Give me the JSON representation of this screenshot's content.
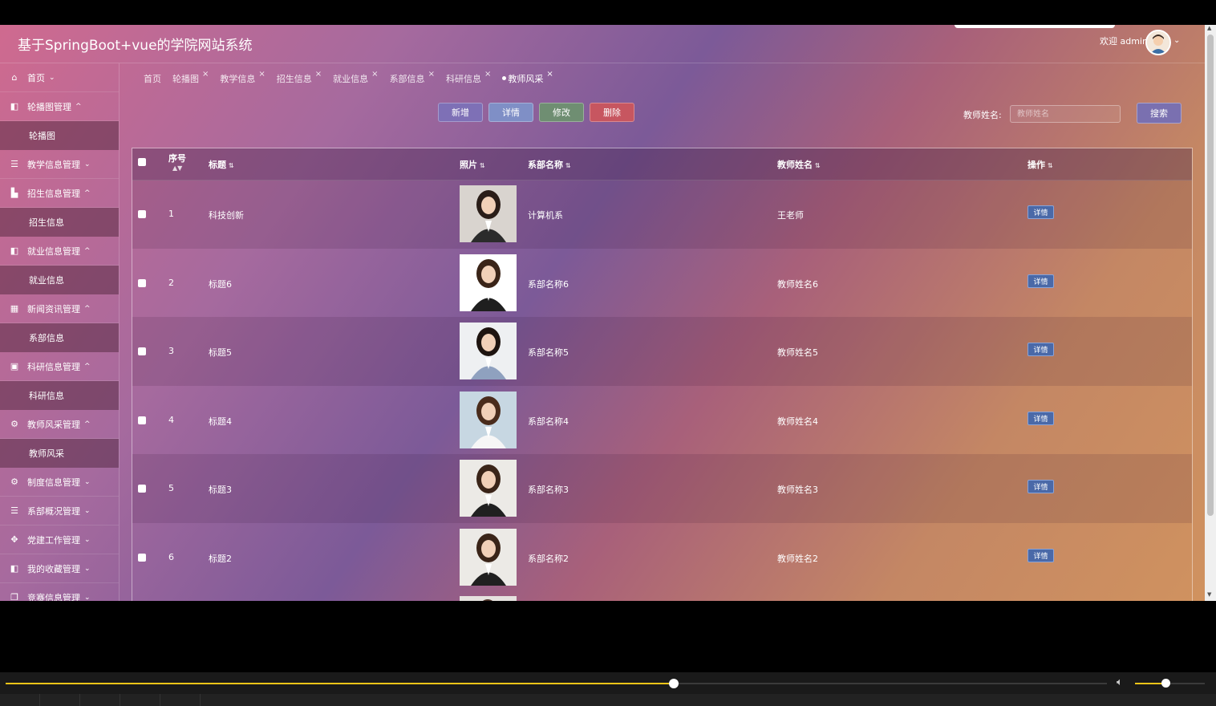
{
  "header": {
    "title": "基于SpringBoot+vue的学院网站系统",
    "welcome": "欢迎 admin"
  },
  "sidebar": {
    "items": [
      {
        "label": "首页",
        "type": "group",
        "icon": "home-icon",
        "glyph": "⌂",
        "caret": "⌄"
      },
      {
        "label": "轮播图管理",
        "type": "group",
        "icon": "panel-icon",
        "glyph": "◧",
        "caret": "^"
      },
      {
        "label": "轮播图",
        "type": "sub"
      },
      {
        "label": "教学信息管理",
        "type": "group",
        "icon": "database-icon",
        "glyph": "☰",
        "caret": "⌄"
      },
      {
        "label": "招生信息管理",
        "type": "group",
        "icon": "building-icon",
        "glyph": "▙",
        "caret": "^"
      },
      {
        "label": "招生信息",
        "type": "sub"
      },
      {
        "label": "就业信息管理",
        "type": "group",
        "icon": "panel-icon",
        "glyph": "◧",
        "caret": "^"
      },
      {
        "label": "就业信息",
        "type": "sub"
      },
      {
        "label": "新闻资讯管理",
        "type": "group",
        "icon": "grid-icon",
        "glyph": "▦",
        "caret": "^"
      },
      {
        "label": "系部信息",
        "type": "sub"
      },
      {
        "label": "科研信息管理",
        "type": "group",
        "icon": "briefcase-icon",
        "glyph": "▣",
        "caret": "^"
      },
      {
        "label": "科研信息",
        "type": "sub"
      },
      {
        "label": "教师风采管理",
        "type": "group",
        "icon": "gear-icon",
        "glyph": "⚙",
        "caret": "^"
      },
      {
        "label": "教师风采",
        "type": "sub"
      },
      {
        "label": "制度信息管理",
        "type": "group",
        "icon": "gear-icon",
        "glyph": "⚙",
        "caret": "⌄"
      },
      {
        "label": "系部概况管理",
        "type": "group",
        "icon": "server-icon",
        "glyph": "☰",
        "caret": "⌄"
      },
      {
        "label": "党建工作管理",
        "type": "group",
        "icon": "apps-icon",
        "glyph": "✥",
        "caret": "⌄"
      },
      {
        "label": "我的收藏管理",
        "type": "group",
        "icon": "panel-icon",
        "glyph": "◧",
        "caret": "⌄"
      },
      {
        "label": "竞赛信息管理",
        "type": "group",
        "icon": "copy-icon",
        "glyph": "❐",
        "caret": "⌄"
      }
    ]
  },
  "tabs": [
    {
      "label": "首页",
      "closable": false,
      "active": false
    },
    {
      "label": "轮播图",
      "closable": true,
      "active": false
    },
    {
      "label": "教学信息",
      "closable": true,
      "active": false
    },
    {
      "label": "招生信息",
      "closable": true,
      "active": false
    },
    {
      "label": "就业信息",
      "closable": true,
      "active": false
    },
    {
      "label": "系部信息",
      "closable": true,
      "active": false
    },
    {
      "label": "科研信息",
      "closable": true,
      "active": false
    },
    {
      "label": "教师风采",
      "closable": true,
      "active": true
    }
  ],
  "toolbar": {
    "add": "新增",
    "detail": "详情",
    "edit": "修改",
    "delete": "删除",
    "search_label": "教师姓名:",
    "search_placeholder": "教师姓名",
    "search_button": "搜索"
  },
  "table": {
    "columns": {
      "index": "序号",
      "title": "标题",
      "photo": "照片",
      "dept": "系部名称",
      "teacher": "教师姓名",
      "action": "操作"
    },
    "action_label": "详情",
    "rows": [
      {
        "index": "1",
        "title": "科技创新",
        "dept": "计算机系",
        "teacher": "王老师"
      },
      {
        "index": "2",
        "title": "标题6",
        "dept": "系部名称6",
        "teacher": "教师姓名6"
      },
      {
        "index": "3",
        "title": "标题5",
        "dept": "系部名称5",
        "teacher": "教师姓名5"
      },
      {
        "index": "4",
        "title": "标题4",
        "dept": "系部名称4",
        "teacher": "教师姓名4"
      },
      {
        "index": "5",
        "title": "标题3",
        "dept": "系部名称3",
        "teacher": "教师姓名3"
      },
      {
        "index": "6",
        "title": "标题2",
        "dept": "系部名称2",
        "teacher": "教师姓名2"
      }
    ]
  },
  "player": {
    "progress": 0.607,
    "volume": 0.44
  },
  "colors": {
    "accent": "#f5c518",
    "add": "#7e70b6",
    "detail": "#7f8fc6",
    "edit": "#6f8e72",
    "delete": "#c75660",
    "tag": "#4a69a8"
  }
}
